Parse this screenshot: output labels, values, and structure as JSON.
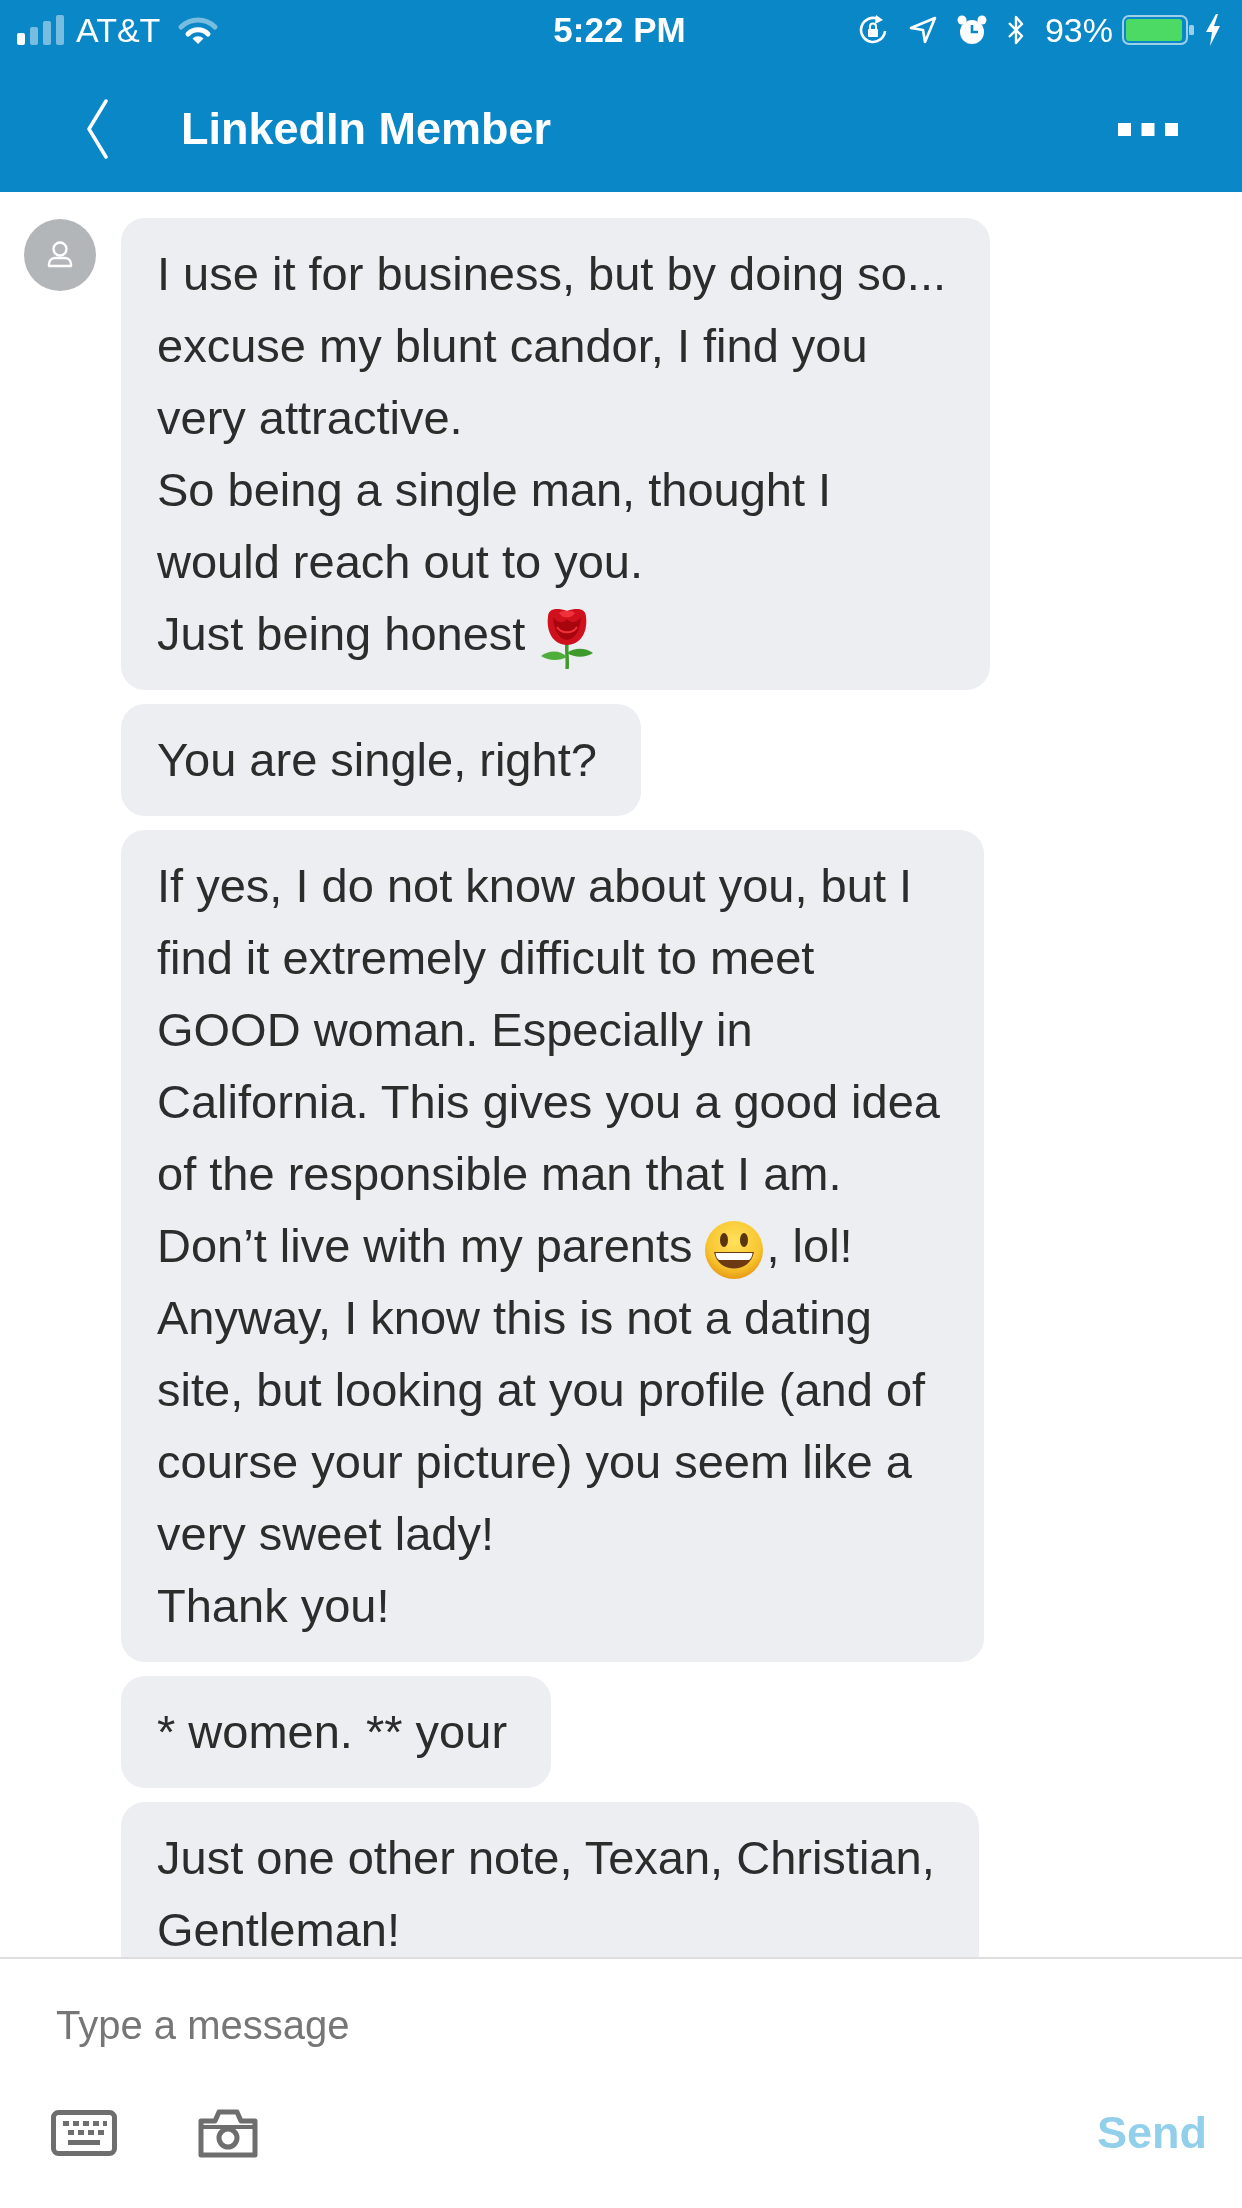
{
  "status_bar": {
    "carrier": "AT&T",
    "time": "5:22 PM",
    "battery_percent": "93%"
  },
  "header": {
    "title": "LinkedIn Member"
  },
  "messages": [
    {
      "paragraphs": [
        [
          {
            "kind": "text",
            "text": "I use it for business, but by doing so...\nexcuse my blunt candor, I find you\nvery attractive.\nSo being a single man, thought I\nwould reach out to you."
          }
        ],
        [
          {
            "kind": "text",
            "text": "Just being honest"
          },
          {
            "kind": "rose"
          }
        ]
      ]
    },
    {
      "paragraphs": [
        [
          {
            "kind": "text",
            "text": "You are single, right?"
          }
        ]
      ]
    },
    {
      "paragraphs": [
        [
          {
            "kind": "text",
            "text": "If yes, I do not know about you, but I\nfind it extremely difficult to meet\nGOOD woman. Especially in\nCalifornia. This gives you a good idea\nof the responsible man that I am."
          }
        ],
        [
          {
            "kind": "text",
            "text": "Don’t live with my parents"
          },
          {
            "kind": "smiley"
          },
          {
            "kind": "text",
            "text": ", lol!"
          }
        ],
        [
          {
            "kind": "text",
            "text": "Anyway, I know this is not a dating\nsite, but looking at you profile (and of\ncourse your picture) you seem like a\nvery sweet lady!\nThank you!"
          }
        ]
      ]
    },
    {
      "paragraphs": [
        [
          {
            "kind": "text",
            "text": "* women. ** your"
          }
        ]
      ]
    },
    {
      "paragraphs": [
        [
          {
            "kind": "text",
            "text": "Just one other note, Texan, Christian,\nGentleman!"
          }
        ]
      ]
    }
  ],
  "composer": {
    "placeholder": "Type a message",
    "send": {
      "label": "Send",
      "disabled": true
    }
  }
}
